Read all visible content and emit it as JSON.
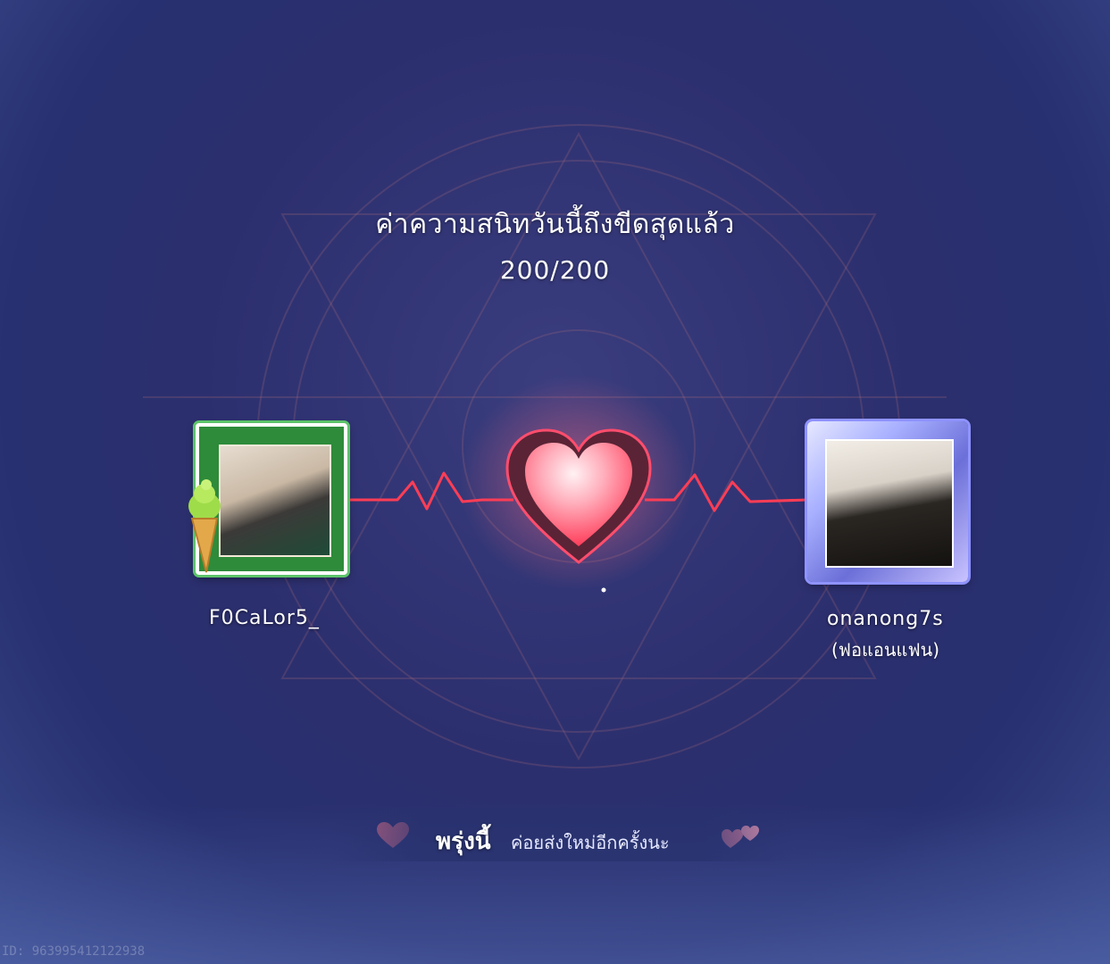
{
  "header": {
    "title": "ค่าความสนิทวันนี้ถึงขีดสุดแล้ว",
    "score": "200/200"
  },
  "players": {
    "left": {
      "name": "F0CaLor5_"
    },
    "right": {
      "name": "onanong7s",
      "relation": "(ฟอแอนแฟน)"
    }
  },
  "banner": {
    "strong": "พรุ่งนี้",
    "text": "ค่อยส่งใหม่อีกครั้งนะ"
  },
  "footer": {
    "id_text": "ID: 963995412122938"
  },
  "colors": {
    "background": "#2c2f6e",
    "heart": "#ff4d6d",
    "pulse_line": "#ff3d55"
  }
}
